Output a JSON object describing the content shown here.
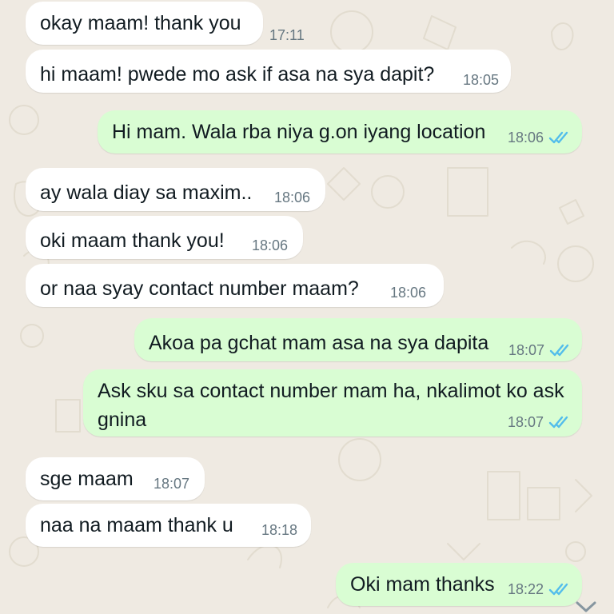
{
  "colors": {
    "background": "#efeae2",
    "incoming_bubble": "#ffffff",
    "outgoing_bubble": "#d9fdd3",
    "text": "#111b21",
    "timestamp": "#667781",
    "read_ticks": "#53bdeb"
  },
  "messages": [
    {
      "direction": "incoming",
      "text": "okay maam! thank you",
      "time": "17:11"
    },
    {
      "direction": "incoming",
      "text": "hi maam! pwede mo ask if asa na sya dapit?",
      "time": "18:05"
    },
    {
      "direction": "outgoing",
      "text": "Hi mam. Wala rba niya g.on iyang location",
      "time": "18:06",
      "status": "read"
    },
    {
      "direction": "incoming",
      "text": "ay wala diay sa maxim..",
      "time": "18:06"
    },
    {
      "direction": "incoming",
      "text": "oki maam thank you!",
      "time": "18:06"
    },
    {
      "direction": "incoming",
      "text": "or naa syay contact number maam?",
      "time": "18:06"
    },
    {
      "direction": "outgoing",
      "text": "Akoa pa gchat mam asa na sya dapita",
      "time": "18:07",
      "status": "read"
    },
    {
      "direction": "outgoing",
      "text": "Ask sku sa contact number mam ha, nkalimot ko ask gnina",
      "time": "18:07",
      "status": "read"
    },
    {
      "direction": "incoming",
      "text": "sge maam",
      "time": "18:07"
    },
    {
      "direction": "incoming",
      "text": "naa na maam thank u",
      "time": "18:18"
    },
    {
      "direction": "outgoing",
      "text": "Oki mam thanks",
      "time": "18:22",
      "status": "read"
    }
  ],
  "icons": {
    "read_receipt": "double-check-icon",
    "scroll_down": "chevron-down-icon"
  }
}
